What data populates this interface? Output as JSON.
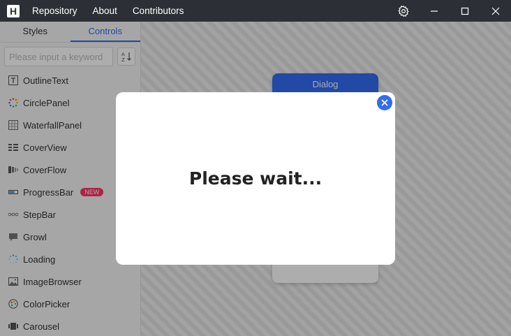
{
  "app": {
    "logo": "H",
    "menu": [
      "Repository",
      "About",
      "Contributors"
    ]
  },
  "side": {
    "tabs": [
      "Styles",
      "Controls"
    ],
    "active_tab": "Controls",
    "search_placeholder": "Please input a keyword",
    "items": [
      {
        "label": "OutlineText",
        "icon": "outline-text-icon"
      },
      {
        "label": "CirclePanel",
        "icon": "circle-panel-icon"
      },
      {
        "label": "WaterfallPanel",
        "icon": "waterfall-panel-icon"
      },
      {
        "label": "CoverView",
        "icon": "cover-view-icon"
      },
      {
        "label": "CoverFlow",
        "icon": "cover-flow-icon"
      },
      {
        "label": "ProgressBar",
        "icon": "progress-bar-icon",
        "badge": "NEW"
      },
      {
        "label": "StepBar",
        "icon": "step-bar-icon"
      },
      {
        "label": "Growl",
        "icon": "growl-icon"
      },
      {
        "label": "Loading",
        "icon": "loading-icon"
      },
      {
        "label": "ImageBrowser",
        "icon": "image-browser-icon"
      },
      {
        "label": "ColorPicker",
        "icon": "color-picker-icon"
      },
      {
        "label": "Carousel",
        "icon": "carousel-icon"
      }
    ]
  },
  "main": {
    "dialog_button": "Dialog"
  },
  "modal": {
    "text": "Please wait..."
  },
  "colors": {
    "accent": "#326cf3",
    "titlebar": "#2c3036",
    "badge": "#ff3366"
  }
}
